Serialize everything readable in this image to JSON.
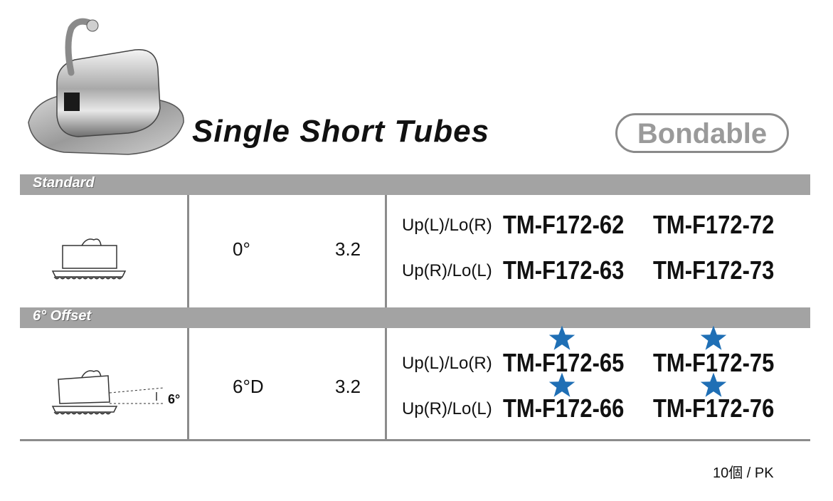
{
  "title": "Single Short Tubes",
  "badge": "Bondable",
  "sections": [
    {
      "name": "Standard",
      "angle": "0°",
      "size": "3.2",
      "rows": [
        {
          "label": "Up(L)/Lo(R)",
          "code1": "TM-F172-62",
          "code2": "TM-F172-72",
          "starred": false
        },
        {
          "label": "Up(R)/Lo(L)",
          "code1": "TM-F172-63",
          "code2": "TM-F172-73",
          "starred": false
        }
      ]
    },
    {
      "name": "6° Offset",
      "angle": "6°D",
      "size": "3.2",
      "diagram_label": "6°",
      "rows": [
        {
          "label": "Up(L)/Lo(R)",
          "code1": "TM-F172-65",
          "code2": "TM-F172-75",
          "starred": true
        },
        {
          "label": "Up(R)/Lo(L)",
          "code1": "TM-F172-66",
          "code2": "TM-F172-76",
          "starred": true
        }
      ]
    }
  ],
  "footer": "10個 / PK",
  "colors": {
    "band": "#a3a3a3",
    "star": "#1f6fb5",
    "badge": "#9a9a9a"
  },
  "icons": [
    "buccal-tube-photo",
    "tube-diagram-standard",
    "tube-diagram-offset",
    "star-icon"
  ]
}
